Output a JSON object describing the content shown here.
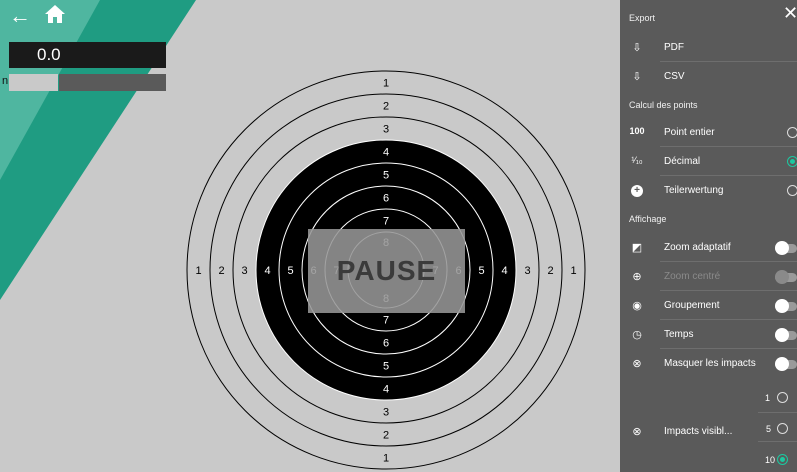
{
  "header": {
    "back_icon": "back-arrow-icon",
    "home_icon": "home-icon"
  },
  "score": {
    "value": "0.0"
  },
  "bar": {
    "left_label": "n"
  },
  "target": {
    "outer_labels": [
      "1",
      "2",
      "3"
    ],
    "inner_labels": [
      "4",
      "5",
      "6",
      "7",
      "8"
    ],
    "side_labels": [
      "1",
      "2",
      "3",
      "4",
      "5",
      "6",
      "7"
    ],
    "pause": "PAUSE"
  },
  "panel": {
    "export_title": "Export",
    "export_items": [
      {
        "label": "PDF",
        "icon": "download-icon"
      },
      {
        "label": "CSV",
        "icon": "download-icon"
      }
    ],
    "points_title": "Calcul des points",
    "points_items": [
      {
        "prefix": "100",
        "label": "Point entier",
        "selected": false
      },
      {
        "prefix": "¹⁄₁₀",
        "label": "Décimal",
        "selected": true
      },
      {
        "prefix": "+",
        "label": "Teilerwertung",
        "selected": false
      }
    ],
    "display_title": "Affichage",
    "display_items": [
      {
        "label": "Zoom adaptatif",
        "icon": "crop-icon",
        "disabled": false
      },
      {
        "label": "Zoom centré",
        "icon": "crosshair-icon",
        "disabled": true
      },
      {
        "label": "Groupement",
        "icon": "eye-icon",
        "disabled": false
      },
      {
        "label": "Temps",
        "icon": "timer-icon",
        "disabled": false
      },
      {
        "label": "Masquer les impacts",
        "icon": "hide-impacts-icon",
        "disabled": false
      }
    ],
    "visible_impacts": {
      "label": "Impacts visibl...",
      "options": [
        {
          "value": "1",
          "selected": false
        },
        {
          "value": "5",
          "selected": false
        },
        {
          "value": "10",
          "selected": true
        }
      ]
    }
  }
}
